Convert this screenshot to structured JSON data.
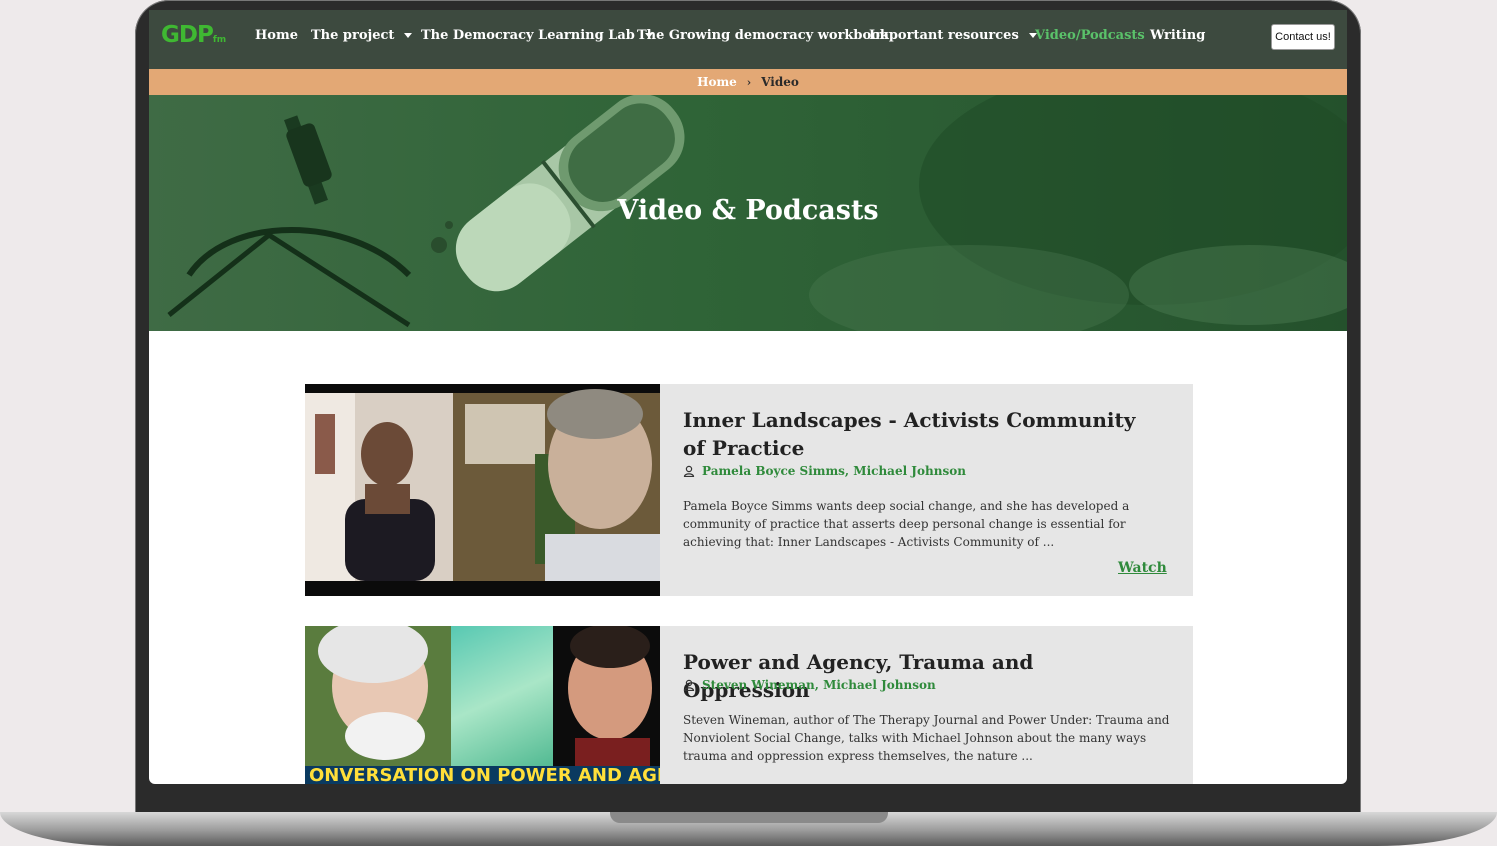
{
  "nav": {
    "logo": "GDP",
    "logo_suffix": "fm",
    "items": [
      {
        "label": "Home",
        "has_dropdown": false
      },
      {
        "label": "The project",
        "has_dropdown": true
      },
      {
        "label": "The Democracy Learning Lab",
        "has_dropdown": true
      },
      {
        "label": "The Growing democracy workbook",
        "has_dropdown": false
      },
      {
        "label": "Important resources",
        "has_dropdown": true
      },
      {
        "label": "Video/Podcasts",
        "has_dropdown": false
      },
      {
        "label": "Writing",
        "has_dropdown": false
      }
    ],
    "contact_label": "Contact us!"
  },
  "breadcrumb": {
    "home": "Home",
    "separator": "›",
    "current": "Video"
  },
  "hero": {
    "title": "Video & Podcasts"
  },
  "posts": [
    {
      "title": "Inner Landscapes - Activists Community of Practice",
      "authors": "Pamela Boyce Simms, Michael Johnson",
      "excerpt": "Pamela Boyce Simms wants deep social change, and she has developed a community of practice that asserts deep personal change is essential for achieving that: Inner Landscapes - Activists Community of ...",
      "watch_label": "Watch"
    },
    {
      "title": "Power and Agency, Trauma and Oppression",
      "authors": "Steven Wineman, Michael Johnson",
      "excerpt": "Steven Wineman, author of The Therapy Journal and Power Under: Trauma and Nonviolent Social Change, talks with Michael Johnson about the many ways trauma and oppression express themselves, the nature ...",
      "thumb_caption": "ONVERSATION ON POWER AND AGEN"
    }
  ],
  "colors": {
    "nav_bg": "#3d4a3f",
    "accent_green": "#2f8a3b",
    "active_nav": "#5ac26a",
    "breadcrumb_bg": "#e3a875",
    "hero_green": "#2f6437",
    "card_bg": "#e6e6e6"
  },
  "icons": [
    "caret-down-icon",
    "chevron-right-icon",
    "user-icon"
  ]
}
